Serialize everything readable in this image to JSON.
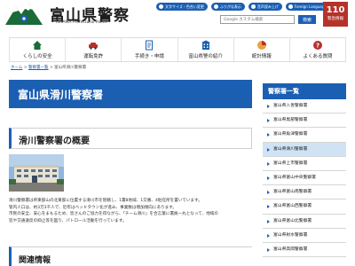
{
  "header": {
    "logo_title": "富山県警察",
    "logo_sub": "TOYAMA Prefectural Police",
    "util_buttons": [
      "文字サイズ・色合い変更",
      "ふりがな表示",
      "音声読み上げ",
      "Foreign Language"
    ],
    "search_placeholder": "Google カスタム検索",
    "search_button": "検索",
    "badge_label": "緊急情報",
    "badge_glyph": "110"
  },
  "nav": {
    "items": [
      {
        "label": "くらしの安全",
        "icon": "home-icon"
      },
      {
        "label": "運転免許",
        "icon": "car-icon"
      },
      {
        "label": "手続き・申請",
        "icon": "document-icon"
      },
      {
        "label": "富山県警の紹介",
        "icon": "building-icon"
      },
      {
        "label": "統計情報",
        "icon": "chart-icon"
      },
      {
        "label": "よくある質問",
        "icon": "question-icon"
      }
    ]
  },
  "breadcrumb": {
    "home": "ホーム",
    "sep1": " > ",
    "level2": "警察署一覧",
    "sep2": " > ",
    "current": "富山県滑川警察署"
  },
  "main": {
    "page_title": "富山県滑川警察署",
    "section_title": "滑川警察署の概要",
    "body_lines": [
      "滑川警察署は県東部山の北東部に位置する滑川市を管轄し、1署8地域、1交番、4駐在所を置いています。",
      "管内人口は、約3万3千人で、近年はベッドタウン化が進み、事業数は増加傾向にあります。",
      "市民の安全、安心をまもるため、皆さんのご協力を得ながら、「チーム滑川」を合言葉に署員一丸となって、地域の",
      "犯や交通違反の抑止等を図り、パトロール活動を行っています。"
    ],
    "related_title": "関連情報"
  },
  "sidebar": {
    "title": "警察署一覧",
    "items": [
      "富山県入善警察署",
      "富山県黒部警察署",
      "富山県魚津警察署",
      "富山県滑川警察署",
      "富山県上市警察署",
      "富山県富山中央警察署",
      "富山県富山南警察署",
      "富山県富山西警察署",
      "富山県富山北警察署",
      "富山県射水警察署",
      "富山県高岡警察署"
    ],
    "active_index": 3
  },
  "colors": {
    "brand_blue": "#1b5fb3",
    "badge_red": "#b5322a",
    "active_bg": "#cfe3f5"
  }
}
